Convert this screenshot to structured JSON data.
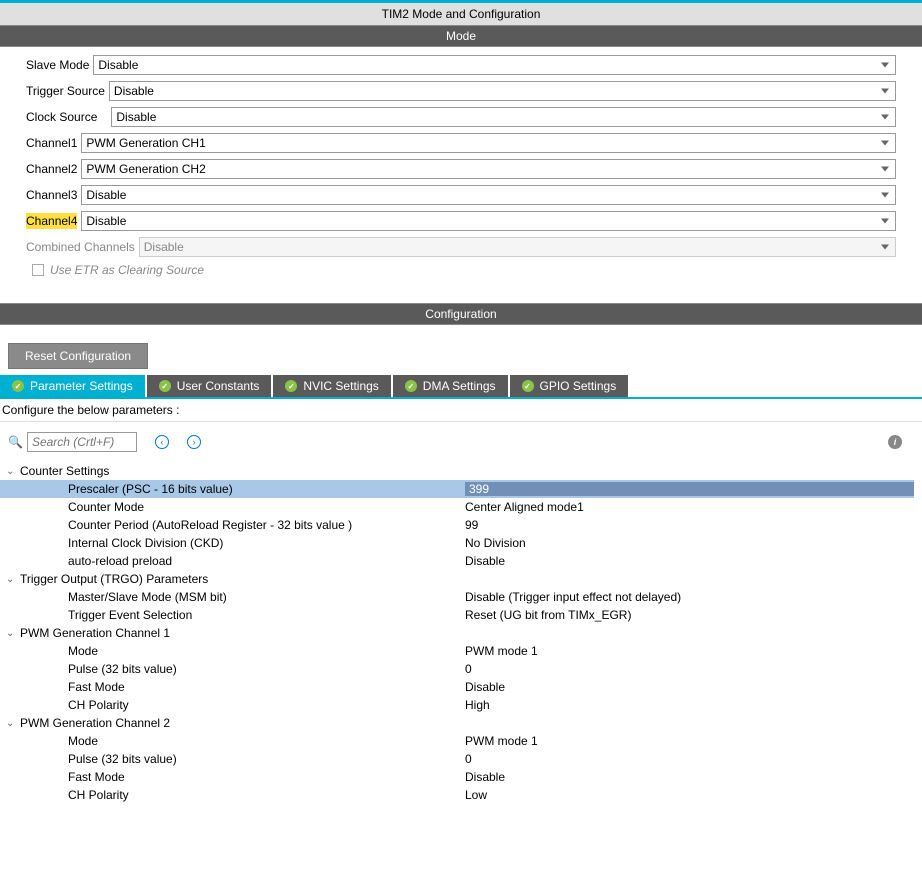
{
  "title": "TIM2 Mode and Configuration",
  "sections": {
    "mode": "Mode",
    "config": "Configuration"
  },
  "mode": {
    "rows": [
      {
        "label": "Slave Mode",
        "value": "Disable"
      },
      {
        "label": "Trigger Source",
        "value": "Disable"
      },
      {
        "label": "Clock Source",
        "value": "Disable"
      },
      {
        "label": "Channel1",
        "value": "PWM Generation CH1"
      },
      {
        "label": "Channel2",
        "value": "PWM Generation CH2"
      },
      {
        "label": "Channel3",
        "value": "Disable"
      },
      {
        "label": "Channel4",
        "value": "Disable"
      },
      {
        "label": "Combined Channels",
        "value": "Disable"
      }
    ],
    "etr_check": "Use ETR as Clearing Source"
  },
  "reset_button": "Reset Configuration",
  "tabs": [
    {
      "label": "Parameter Settings"
    },
    {
      "label": "User Constants"
    },
    {
      "label": "NVIC Settings"
    },
    {
      "label": "DMA Settings"
    },
    {
      "label": "GPIO Settings"
    }
  ],
  "subtext": "Configure the below parameters :",
  "search": {
    "placeholder": "Search (Crtl+F)"
  },
  "groups": [
    {
      "title": "Counter Settings",
      "params": [
        {
          "name": "Prescaler (PSC - 16 bits value)",
          "value": "399",
          "selected": true
        },
        {
          "name": "Counter Mode",
          "value": "Center Aligned mode1"
        },
        {
          "name": "Counter Period (AutoReload Register - 32 bits value )",
          "value": "99"
        },
        {
          "name": "Internal Clock Division (CKD)",
          "value": "No Division"
        },
        {
          "name": "auto-reload preload",
          "value": "Disable"
        }
      ]
    },
    {
      "title": "Trigger Output (TRGO) Parameters",
      "params": [
        {
          "name": "Master/Slave Mode (MSM bit)",
          "value": "Disable (Trigger input effect not delayed)"
        },
        {
          "name": "Trigger Event Selection",
          "value": "Reset (UG bit from TIMx_EGR)"
        }
      ]
    },
    {
      "title": "PWM Generation Channel 1",
      "params": [
        {
          "name": "Mode",
          "value": "PWM mode 1"
        },
        {
          "name": "Pulse (32 bits value)",
          "value": "0"
        },
        {
          "name": "Fast Mode",
          "value": "Disable"
        },
        {
          "name": "CH Polarity",
          "value": "High"
        }
      ]
    },
    {
      "title": "PWM Generation Channel 2",
      "params": [
        {
          "name": "Mode",
          "value": "PWM mode 1"
        },
        {
          "name": "Pulse (32 bits value)",
          "value": "0"
        },
        {
          "name": "Fast Mode",
          "value": "Disable"
        },
        {
          "name": "CH Polarity",
          "value": "Low"
        }
      ]
    }
  ]
}
